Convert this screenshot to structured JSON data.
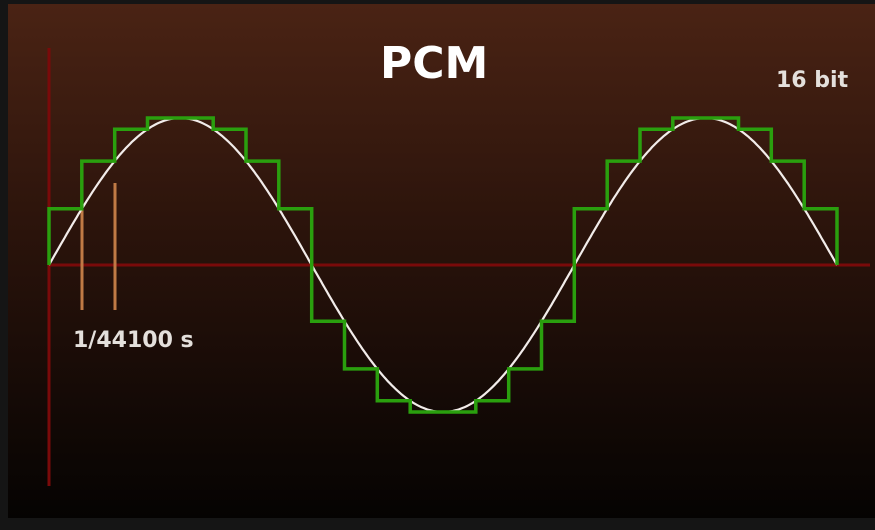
{
  "title": "PCM",
  "bit_depth_label": "16 bit",
  "sample_interval_label": "1/44100 s",
  "colors": {
    "background_top": "#4a2314",
    "background_bottom": "#050302",
    "axis": "#7a0a0a",
    "sine": "#f2ecea",
    "steps": "#2a9f0e",
    "sample_marks": "#c07a45"
  },
  "signal": {
    "periods": 1.5,
    "samples_per_period": 16
  }
}
